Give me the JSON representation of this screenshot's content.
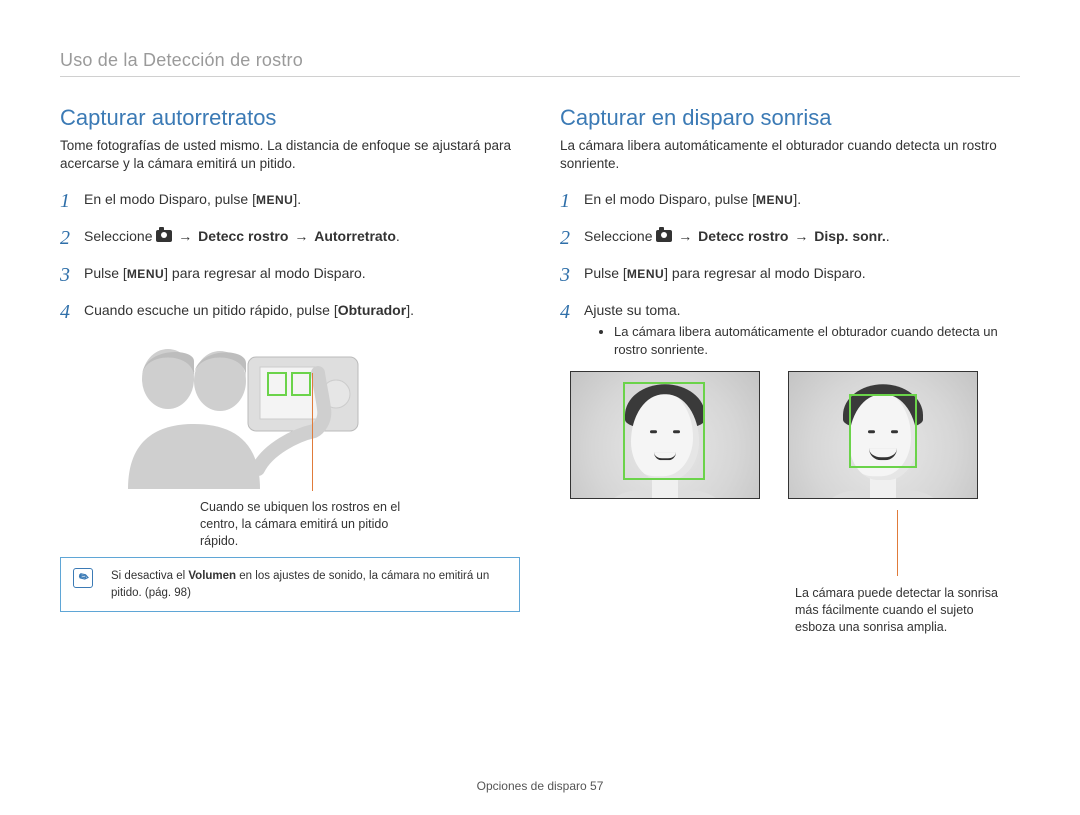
{
  "header": {
    "section_title": "Uso de la Detección de rostro"
  },
  "left": {
    "title": "Capturar autorretratos",
    "intro": "Tome fotografías de usted mismo. La distancia de enfoque se ajustará para acercarse y la cámara emitirá un pitido.",
    "steps": {
      "s1_a": "En el modo Disparo, pulse [",
      "s1_menu": "MENU",
      "s1_b": "].",
      "s2_a": "Seleccione ",
      "s2_arrow": " → ",
      "s2_b1": "Detecc rostro",
      "s2_b2": "Autorretrato",
      "s3_a": "Pulse [",
      "s3_menu": "MENU",
      "s3_b": "] para regresar al modo Disparo.",
      "s4_a": "Cuando escuche un pitido rápido, pulse [",
      "s4_bold": "Obturador",
      "s4_b": "]."
    },
    "callout": "Cuando se ubiquen los rostros en el centro, la cámara emitirá un pitido rápido.",
    "note_a": "Si desactiva el ",
    "note_bold": "Volumen",
    "note_b": " en los ajustes de sonido, la cámara no emitirá un pitido. (pág. 98)"
  },
  "right": {
    "title": "Capturar en disparo sonrisa",
    "intro": "La cámara libera automáticamente el obturador cuando detecta un rostro sonriente.",
    "steps": {
      "s1_a": "En el modo Disparo, pulse [",
      "s1_menu": "MENU",
      "s1_b": "].",
      "s2_a": "Seleccione ",
      "s2_arrow": " → ",
      "s2_b1": "Detecc rostro",
      "s2_b2": "Disp. sonr.",
      "s3_a": "Pulse [",
      "s3_menu": "MENU",
      "s3_b": "] para regresar al modo Disparo.",
      "s4": "Ajuste su toma.",
      "sub": "La cámara libera automáticamente el obturador cuando detecta un rostro sonriente."
    },
    "callout": "La cámara puede detectar la sonrisa más fácilmente cuando el sujeto esboza una sonrisa amplia."
  },
  "footer": {
    "label": "Opciones de disparo  57"
  },
  "nums": {
    "n1": "1",
    "n2": "2",
    "n3": "3",
    "n4": "4"
  }
}
